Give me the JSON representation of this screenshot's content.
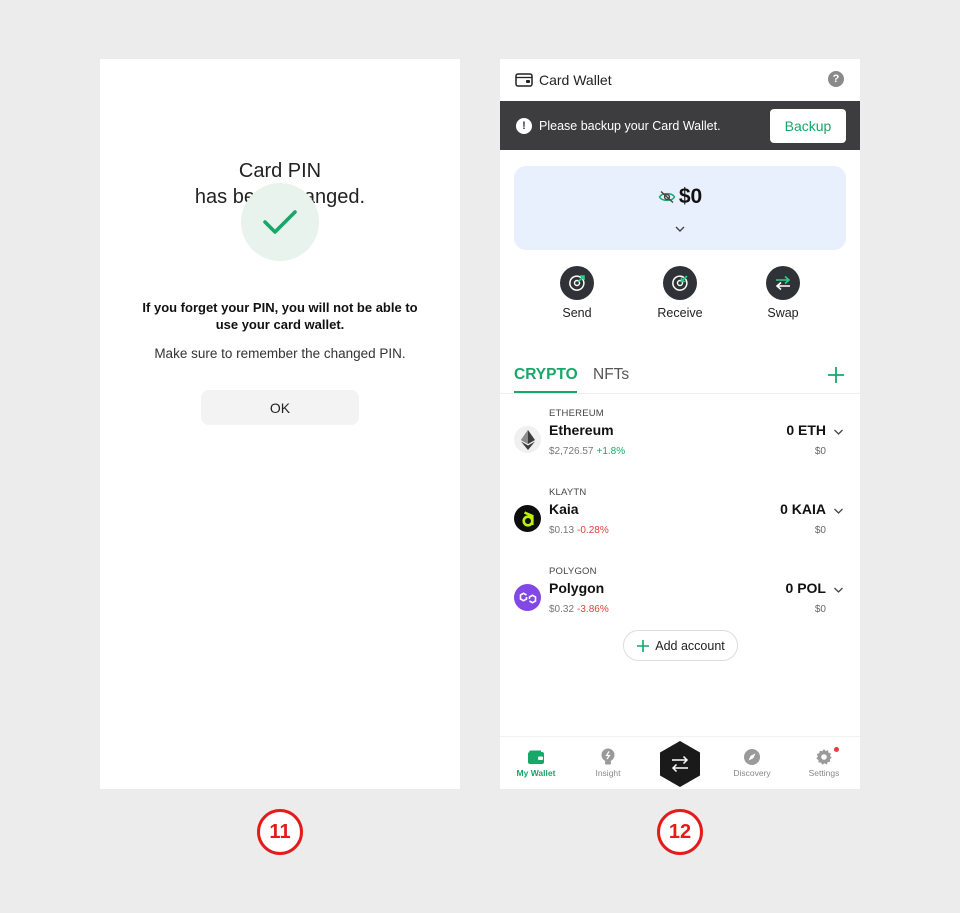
{
  "screen11": {
    "title_line1": "Card PIN",
    "title_line2": "has been changed.",
    "warning": "If you forget your PIN, you will not be able to use your card wallet.",
    "remember": "Make sure to remember the changed PIN.",
    "ok_label": "OK",
    "step": "11"
  },
  "screen12": {
    "header_title": "Card Wallet",
    "help_label": "?",
    "banner_text": "Please backup your Card Wallet.",
    "backup_label": "Backup",
    "balance": "$0",
    "actions": [
      {
        "label": "Send",
        "icon": "send-icon"
      },
      {
        "label": "Receive",
        "icon": "receive-icon"
      },
      {
        "label": "Swap",
        "icon": "swap-icon"
      }
    ],
    "tabs": {
      "crypto": "CRYPTO",
      "nfts": "NFTs"
    },
    "assets": [
      {
        "network": "ETHEREUM",
        "name": "Ethereum",
        "price": "$2,726.57",
        "change": "+1.8%",
        "amount": "0 ETH",
        "usd": "$0",
        "icon": "ethereum-icon"
      },
      {
        "network": "KLAYTN",
        "name": "Kaia",
        "price": "$0.13",
        "change": "-0.28%",
        "amount": "0 KAIA",
        "usd": "$0",
        "icon": "kaia-icon"
      },
      {
        "network": "POLYGON",
        "name": "Polygon",
        "price": "$0.32",
        "change": "-3.86%",
        "amount": "0 POL",
        "usd": "$0",
        "icon": "polygon-icon"
      }
    ],
    "add_account": "Add account",
    "nav": [
      {
        "label": "My Wallet",
        "icon": "wallet-icon",
        "active": true
      },
      {
        "label": "Insight",
        "icon": "bulb-icon"
      },
      {
        "label": "",
        "icon": "swap-hex-icon"
      },
      {
        "label": "Discovery",
        "icon": "compass-icon"
      },
      {
        "label": "Settings",
        "icon": "gear-icon"
      }
    ],
    "step": "12"
  },
  "colors": {
    "accent_green": "#17a769",
    "positive": "#17a769",
    "negative": "#e0413c",
    "banner_bg": "#3d3d3f",
    "balance_card_bg": "#e9f0fd",
    "step_red": "#e31b1b"
  }
}
